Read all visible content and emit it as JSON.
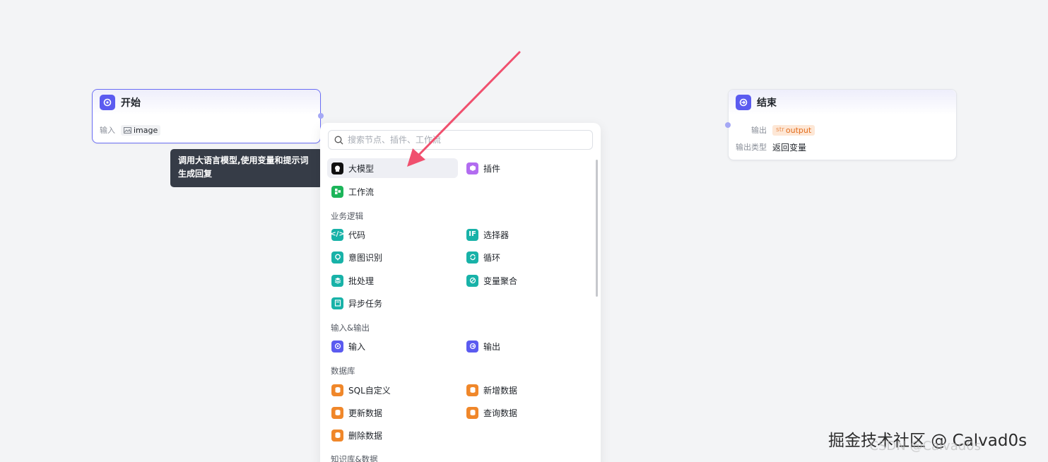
{
  "start_node": {
    "title": "开始",
    "input_label": "输入",
    "input_var": "image"
  },
  "end_node": {
    "title": "结束",
    "output_label": "输出",
    "output_var": "output",
    "output_type_label": "输出类型",
    "output_type_value": "返回变量"
  },
  "tooltip": {
    "line1": "调用大语言模型,使用变量和提示词",
    "line2": "生成回复"
  },
  "panel": {
    "search_placeholder": "搜索节点、插件、工作流",
    "top_items": [
      "大模型",
      "插件",
      "工作流"
    ],
    "sections": {
      "logic": {
        "title": "业务逻辑",
        "items": [
          "代码",
          "选择器",
          "意图识别",
          "循环",
          "批处理",
          "变量聚合",
          "异步任务"
        ]
      },
      "io": {
        "title": "输入&输出",
        "items": [
          "输入",
          "输出"
        ]
      },
      "db": {
        "title": "数据库",
        "items": [
          "SQL自定义",
          "新增数据",
          "更新数据",
          "查询数据",
          "删除数据"
        ]
      },
      "kb": {
        "title": "知识库&数据"
      }
    }
  },
  "watermark": {
    "text": "掘金技术社区 @ Calvad0s",
    "ghost": "CSDN @Calvad0s"
  },
  "colors": {
    "accent": "#5b5bf0",
    "green": "#1cb55a",
    "teal": "#18b2a8",
    "orange": "#f0872a",
    "purple": "#b26cf0",
    "arrow": "#f0506e"
  }
}
